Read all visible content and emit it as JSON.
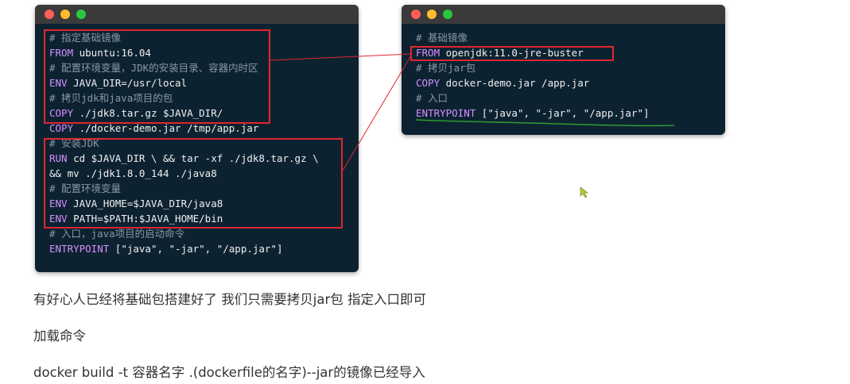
{
  "colors": {
    "window_bg": "#0d2231",
    "titlebar_bg": "#3a3a3a",
    "dot_red": "#ff5f57",
    "dot_yellow": "#febc2e",
    "dot_green": "#28c840",
    "keyword": "#d58fff",
    "comment": "#8a97a5",
    "highlight": "#e0262e",
    "underline": "#2f9a2f",
    "cursor": "#b7c93a"
  },
  "left_code": {
    "lines": [
      {
        "kw": "",
        "rest": "# 指定基础镜像",
        "comment": true
      },
      {
        "kw": "FROM",
        "rest": " ubuntu:16.04",
        "comment": false
      },
      {
        "kw": "",
        "rest": "# 配置环境变量，JDK的安装目录、容器内时区",
        "comment": true
      },
      {
        "kw": "ENV",
        "rest": " JAVA_DIR=/usr/local",
        "comment": false
      },
      {
        "kw": "",
        "rest": "# 拷贝jdk和java项目的包",
        "comment": true
      },
      {
        "kw": "COPY",
        "rest": " ./jdk8.tar.gz $JAVA_DIR/",
        "comment": false
      },
      {
        "kw": "COPY",
        "rest": " ./docker-demo.jar /tmp/app.jar",
        "comment": false
      },
      {
        "kw": "",
        "rest": "# 安装JDK",
        "comment": true
      },
      {
        "kw": "RUN",
        "rest": " cd $JAVA_DIR \\ && tar -xf ./jdk8.tar.gz \\",
        "comment": false
      },
      {
        "kw": "",
        "rest": "&& mv ./jdk1.8.0_144 ./java8",
        "comment": false
      },
      {
        "kw": "",
        "rest": "# 配置环境变量",
        "comment": true
      },
      {
        "kw": "ENV",
        "rest": " JAVA_HOME=$JAVA_DIR/java8",
        "comment": false
      },
      {
        "kw": "ENV",
        "rest": " PATH=$PATH:$JAVA_HOME/bin",
        "comment": false
      },
      {
        "kw": "",
        "rest": "# 入口，java项目的启动命令",
        "comment": true
      },
      {
        "kw": "ENTRYPOINT",
        "rest": " [\"java\", \"-jar\", \"/app.jar\"]",
        "comment": false
      }
    ]
  },
  "right_code": {
    "lines": [
      {
        "kw": "",
        "rest": "# 基础镜像",
        "comment": true
      },
      {
        "kw": "FROM",
        "rest": " openjdk:11.0-jre-buster",
        "comment": false
      },
      {
        "kw": "",
        "rest": "# 拷贝jar包",
        "comment": true
      },
      {
        "kw": "COPY",
        "rest": " docker-demo.jar /app.jar",
        "comment": false
      },
      {
        "kw": "",
        "rest": "# 入口",
        "comment": true
      },
      {
        "kw": "ENTRYPOINT",
        "rest": " [\"java\", \"-jar\", \"/app.jar\"]",
        "comment": false
      }
    ]
  },
  "paragraphs": {
    "p1": "有好心人已经将基础包搭建好了 我们只需要拷贝jar包 指定入口即可",
    "p2": "加载命令",
    "p3": "docker build -t 容器名字 .(dockerfile的名字)--jar的镜像已经导入"
  }
}
